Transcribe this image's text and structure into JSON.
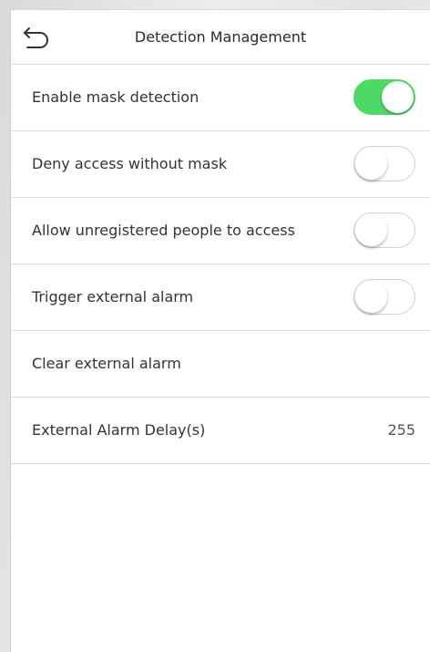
{
  "header": {
    "title": "Detection Management",
    "back_icon": "back-arrow-icon"
  },
  "settings": [
    {
      "label": "Enable mask detection",
      "control": "toggle",
      "state": "on"
    },
    {
      "label": "Deny access without mask",
      "control": "toggle",
      "state": "off"
    },
    {
      "label": "Allow unregistered people to access",
      "control": "toggle",
      "state": "off"
    },
    {
      "label": "Trigger external alarm",
      "control": "toggle",
      "state": "off"
    },
    {
      "label": "Clear external alarm",
      "control": "none"
    },
    {
      "label": "External Alarm Delay(s)",
      "control": "value",
      "value": "255"
    }
  ],
  "colors": {
    "toggle_on": "#4cd964",
    "toggle_off_border": "#d0d0d0",
    "divider": "#dcdcdc"
  }
}
